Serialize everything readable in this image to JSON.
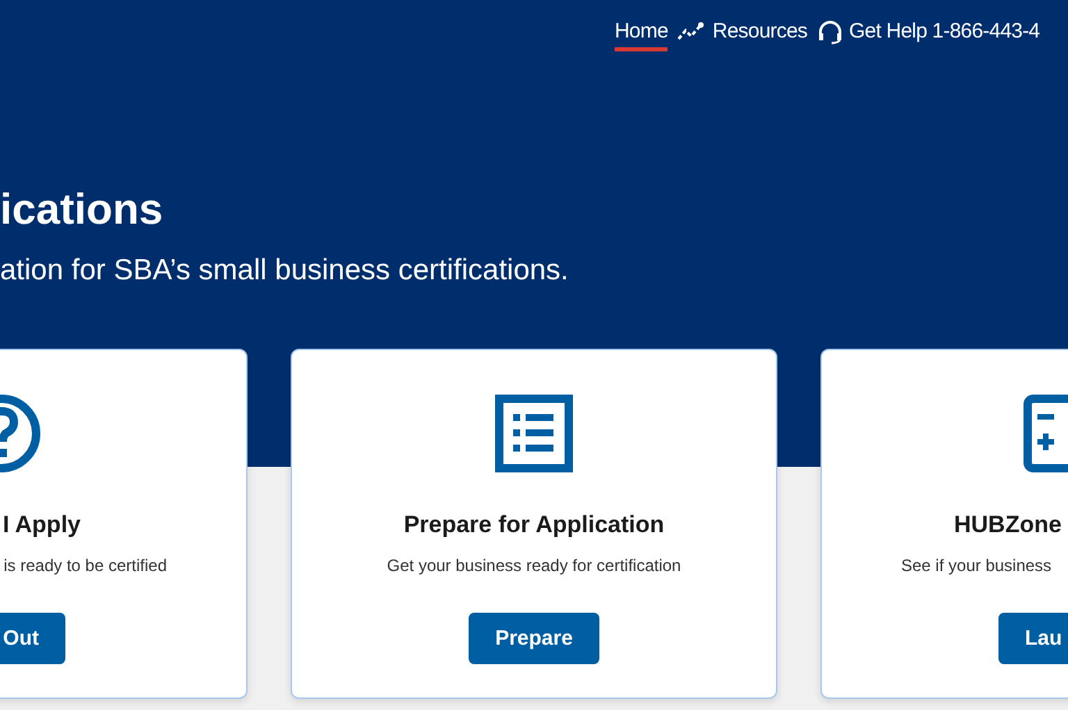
{
  "nav": [
    {
      "label": "Home",
      "selected": true,
      "kind": "plain"
    },
    {
      "label": "Resources",
      "selected": false,
      "kind": "trend"
    },
    {
      "label": "Get Help 1-866-443-4",
      "selected": false,
      "kind": "headset"
    }
  ],
  "hero": {
    "title": "ications",
    "subtitle": "ation for SBA’s small business certifications."
  },
  "cards": [
    {
      "kind": "question",
      "title": "I Apply",
      "description": "is ready to be certified",
      "button": "Out"
    },
    {
      "kind": "list",
      "title": "Prepare for Application",
      "description": "Get your business ready for certification",
      "button": "Prepare"
    },
    {
      "kind": "calculator",
      "title": "HUBZone",
      "description": "See if your business",
      "button": "Lau"
    }
  ]
}
